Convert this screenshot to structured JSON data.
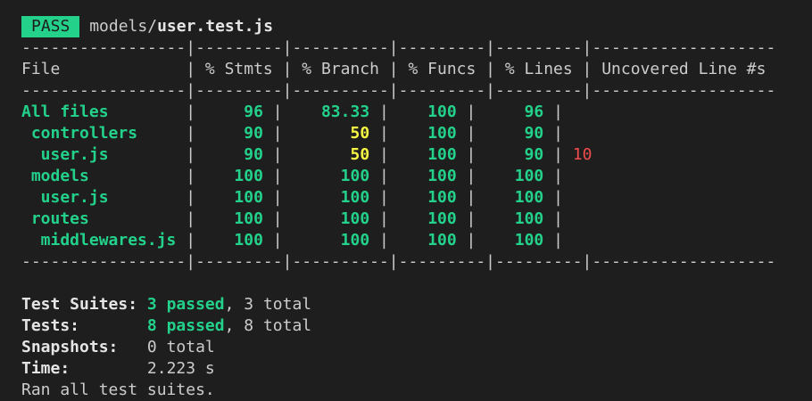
{
  "header": {
    "badge": "PASS",
    "path_dir": "models/",
    "path_file": "user.test.js"
  },
  "table": {
    "separator_top": "-----------------|---------|----------|---------|---------|-------------------",
    "separator_mid": "-----------------|---------|----------|---------|---------|-------------------",
    "separator_bottom": "-----------------|---------|----------|---------|---------|-------------------",
    "header_line": "File             | % Stmts | % Branch | % Funcs | % Lines | Uncovered Line #s ",
    "rows": [
      {
        "file": "All files        ",
        "stmts": "     96 ",
        "branch": "    83.33 ",
        "funcs": "    100 ",
        "lines": "     96 ",
        "uncovered": "",
        "branch_color": "green"
      },
      {
        "file": " controllers     ",
        "stmts": "     90 ",
        "branch": "       50 ",
        "funcs": "    100 ",
        "lines": "     90 ",
        "uncovered": "",
        "branch_color": "yellow"
      },
      {
        "file": "  user.js        ",
        "stmts": "     90 ",
        "branch": "       50 ",
        "funcs": "    100 ",
        "lines": "     90 ",
        "uncovered": "10",
        "branch_color": "yellow"
      },
      {
        "file": " models          ",
        "stmts": "    100 ",
        "branch": "      100 ",
        "funcs": "    100 ",
        "lines": "    100 ",
        "uncovered": "",
        "branch_color": "green"
      },
      {
        "file": "  user.js        ",
        "stmts": "    100 ",
        "branch": "      100 ",
        "funcs": "    100 ",
        "lines": "    100 ",
        "uncovered": "",
        "branch_color": "green"
      },
      {
        "file": " routes          ",
        "stmts": "    100 ",
        "branch": "      100 ",
        "funcs": "    100 ",
        "lines": "    100 ",
        "uncovered": "",
        "branch_color": "green"
      },
      {
        "file": "  middlewares.js ",
        "stmts": "    100 ",
        "branch": "      100 ",
        "funcs": "    100 ",
        "lines": "    100 ",
        "uncovered": "",
        "branch_color": "green"
      }
    ]
  },
  "summary": {
    "suites_label": "Test Suites: ",
    "suites_passed": "3 passed",
    "suites_total": ", 3 total",
    "tests_label": "Tests:       ",
    "tests_passed": "8 passed",
    "tests_total": ", 8 total",
    "snapshots_label": "Snapshots:   ",
    "snapshots_value": "0 total",
    "time_label": "Time:        ",
    "time_value": "2.223 s",
    "ran_all": "Ran all test suites."
  },
  "colors": {
    "background": "#1e1e1e",
    "green": "#23d18b",
    "yellow": "#f5f543",
    "red": "#f14c4c",
    "text": "#cccccc"
  }
}
